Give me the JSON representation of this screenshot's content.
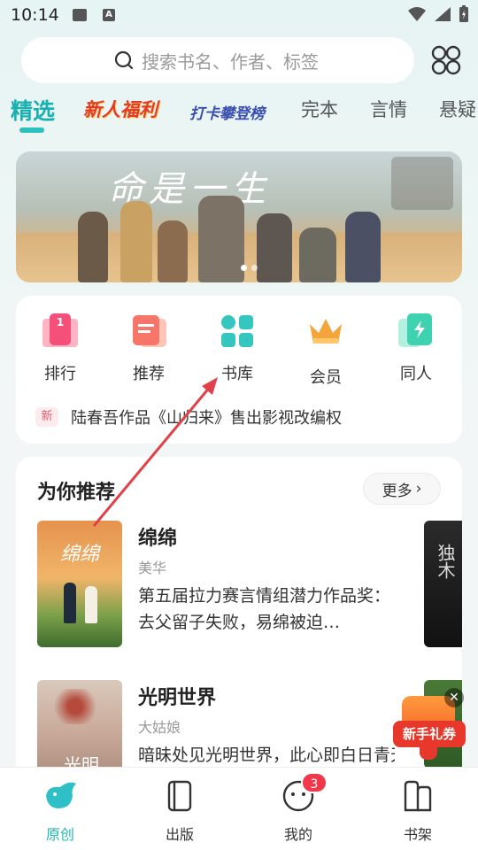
{
  "status": {
    "time": "10:14"
  },
  "search": {
    "placeholder": "搜索书名、作者、标签"
  },
  "tabs": [
    {
      "label": "精选"
    },
    {
      "label": "新人福利"
    },
    {
      "label": "打卡攀登榜"
    },
    {
      "label": "完本"
    },
    {
      "label": "言情"
    },
    {
      "label": "悬疑"
    }
  ],
  "banner": {
    "title": "命是一生"
  },
  "quick_entries": [
    {
      "label": "排行",
      "icon": "ranking-icon",
      "color": "#f5507a"
    },
    {
      "label": "推荐",
      "icon": "recommend-icon",
      "color": "#f7766a"
    },
    {
      "label": "书库",
      "icon": "library-icon",
      "color": "#36c6c0"
    },
    {
      "label": "会员",
      "icon": "crown-icon",
      "color": "#f5a43a"
    },
    {
      "label": "同人",
      "icon": "fanfic-icon",
      "color": "#3ed2b0"
    }
  ],
  "news": {
    "badge": "新",
    "text": "陆春吾作品《山归来》售出影视改编权"
  },
  "recommend": {
    "title": "为你推荐",
    "more_label": "更多",
    "books": [
      {
        "title": "绵绵",
        "author": "美华",
        "desc": "第五届拉力赛言情组潜力作品奖：去父留子失败，易绵被迫…",
        "cover_text": "绵绵"
      },
      {
        "title": "光明世界",
        "author": "大姑娘",
        "desc": "暗昧处见光明世界，此心即白日青天",
        "cover_text": "光明"
      }
    ],
    "side_cover_text": "独木"
  },
  "coupon": {
    "label": "新手礼券"
  },
  "bottom_nav": [
    {
      "label": "原创",
      "icon": "bird-icon"
    },
    {
      "label": "出版",
      "icon": "book-icon"
    },
    {
      "label": "我的",
      "icon": "face-icon"
    },
    {
      "label": "书架",
      "icon": "bookshelf-icon"
    }
  ],
  "profile_badge": "3"
}
